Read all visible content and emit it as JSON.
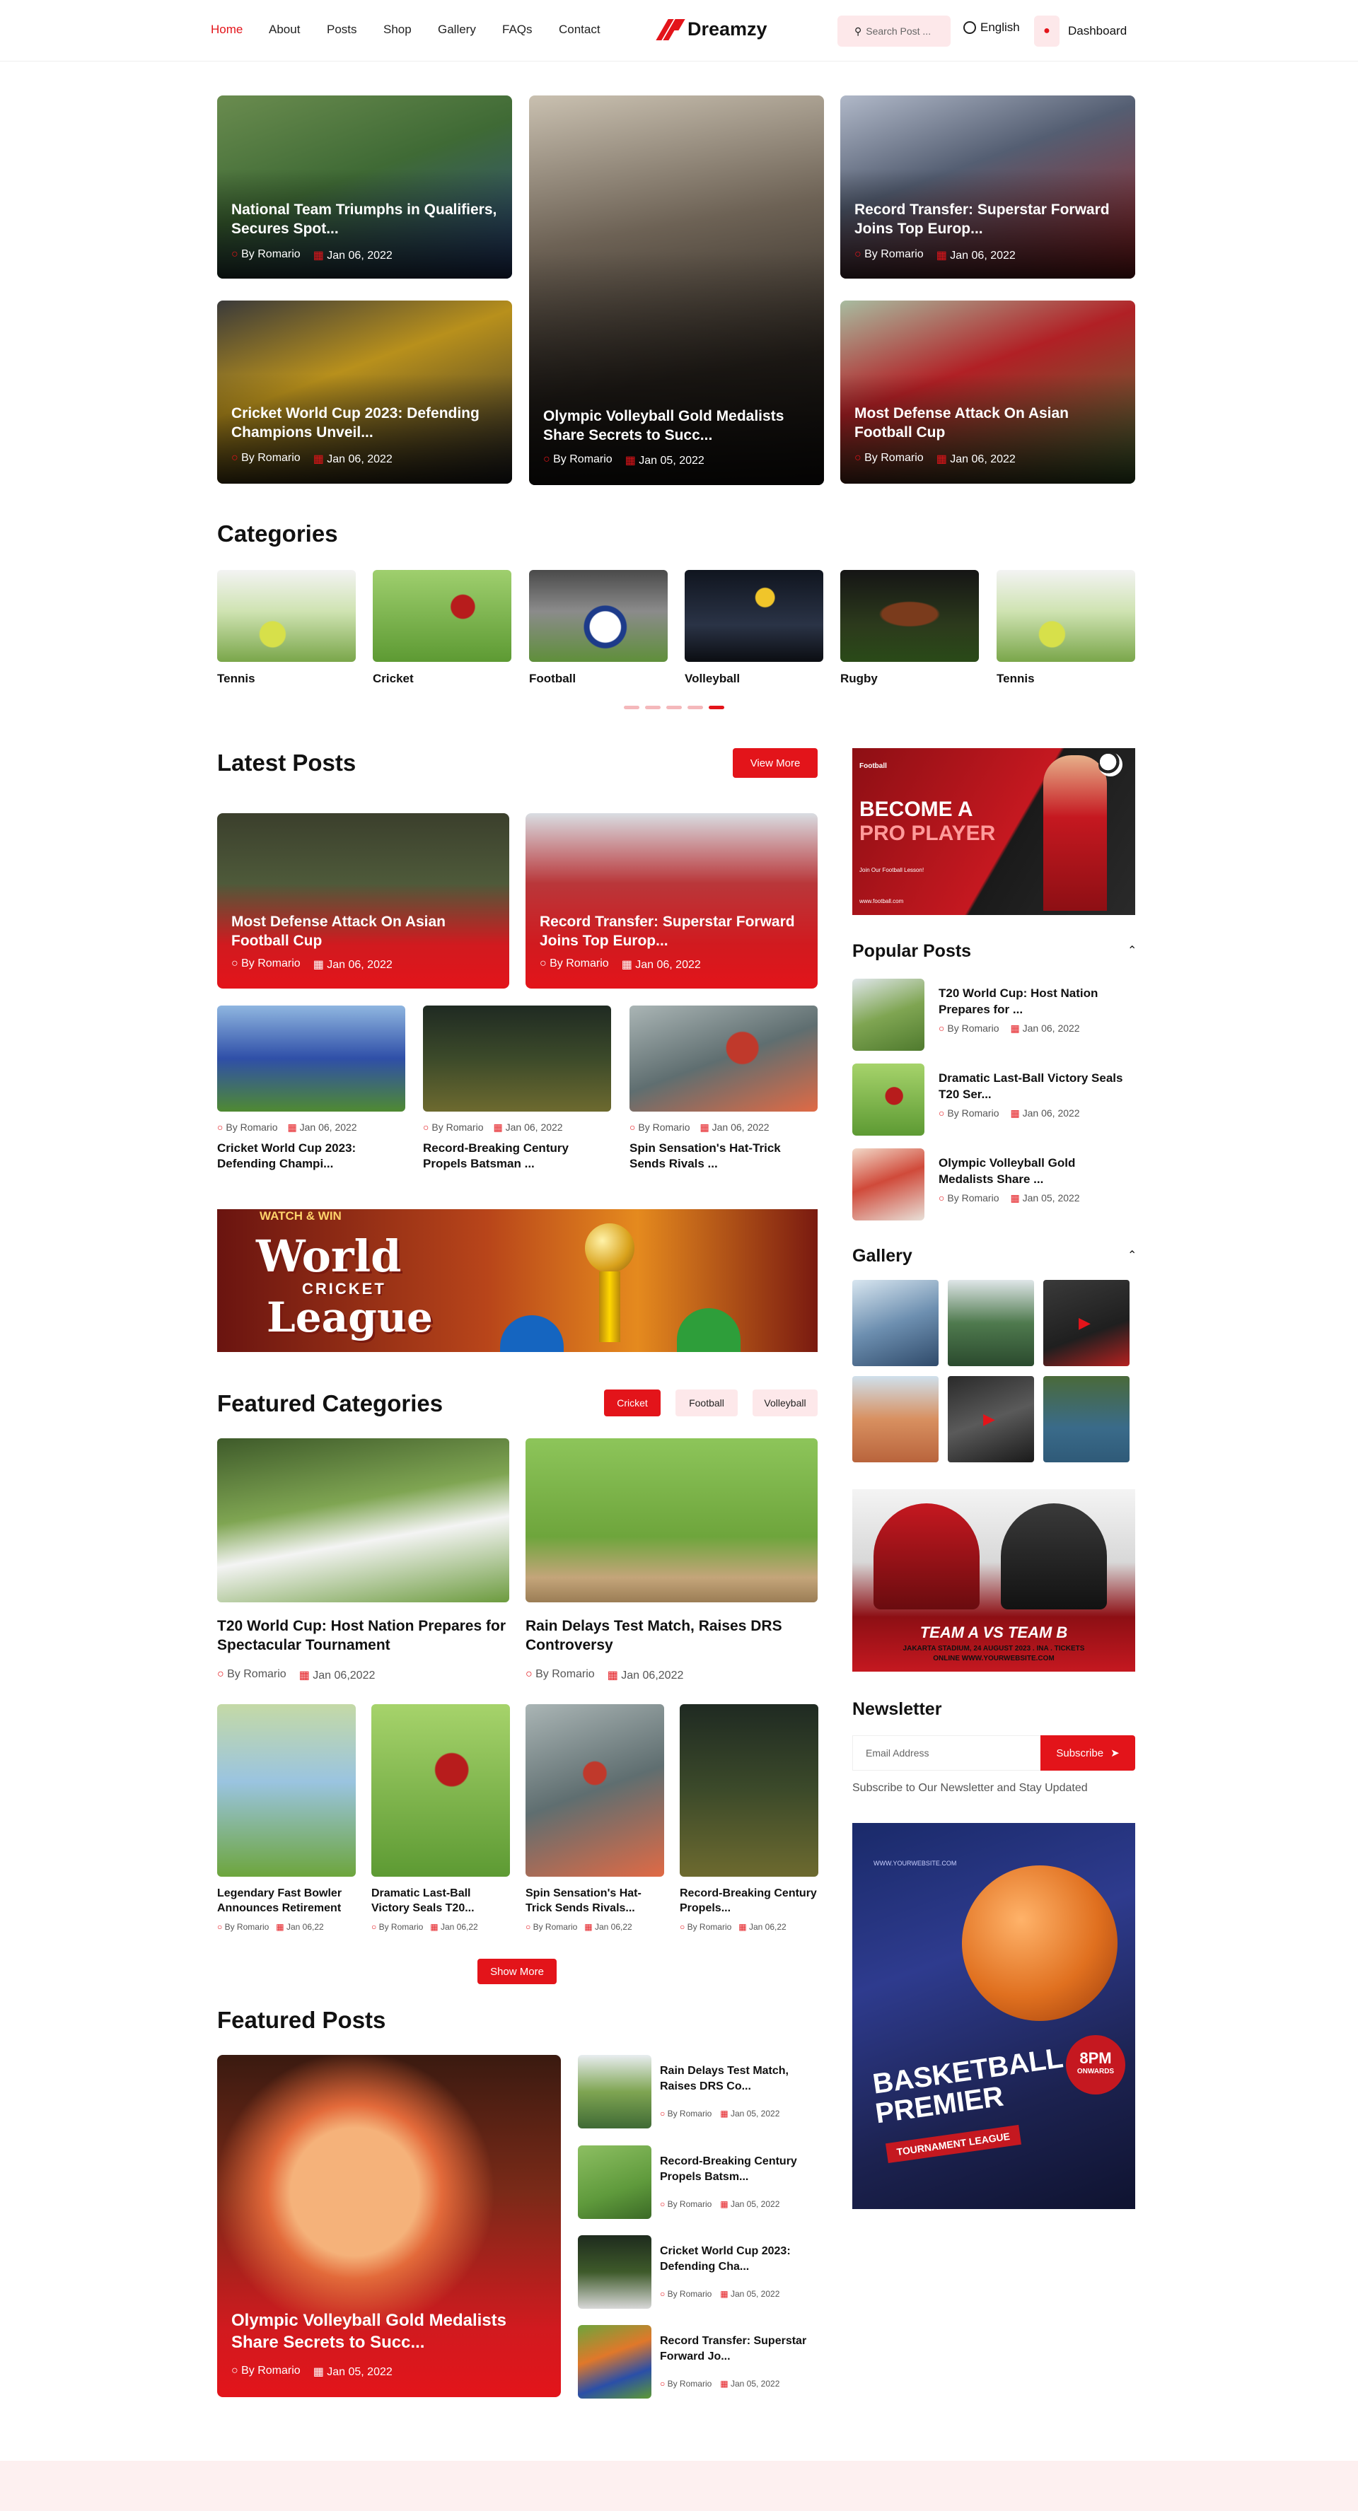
{
  "brand": {
    "name": "Dreamzy",
    "accent": "#e3141a"
  },
  "nav": {
    "items": [
      "Home",
      "About",
      "Posts",
      "Shop",
      "Gallery",
      "FAQs",
      "Contact"
    ],
    "active": "Home"
  },
  "header": {
    "search_placeholder": "Search Post ...",
    "language": "English",
    "dashboard": "Dashboard"
  },
  "hero": [
    {
      "title": "National Team Triumphs in Qualifiers, Secures Spot...",
      "author": "By Romario",
      "date": "Jan 06, 2022"
    },
    {
      "title": "Olympic Volleyball Gold Medalists Share Secrets to Succ...",
      "author": "By Romario",
      "date": "Jan 05, 2022"
    },
    {
      "title": "Record Transfer: Superstar Forward Joins Top Europ...",
      "author": "By Romario",
      "date": "Jan 06, 2022"
    },
    {
      "title": "Cricket World Cup 2023: Defending Champions Unveil...",
      "author": "By Romario",
      "date": "Jan 06, 2022"
    },
    {
      "title": "Most Defense Attack On Asian Football Cup",
      "author": "By Romario",
      "date": "Jan 06, 2022"
    }
  ],
  "categories": {
    "title": "Categories",
    "items": [
      "Tennis",
      "Cricket",
      "Football",
      "Volleyball",
      "Rugby",
      "Tennis"
    ],
    "active_page": 4
  },
  "latest": {
    "title": "Latest Posts",
    "view_more": "View More",
    "big": [
      {
        "title": "Most Defense Attack On Asian Football Cup",
        "author": "By Romario",
        "date": "Jan 06, 2022"
      },
      {
        "title": "Record Transfer: Superstar Forward Joins Top Europ...",
        "author": "By Romario",
        "date": "Jan 06, 2022"
      }
    ],
    "small": [
      {
        "title": "Cricket World Cup 2023: Defending Champi...",
        "author": "By Romario",
        "date": "Jan 06, 2022"
      },
      {
        "title": "Record-Breaking Century Propels Batsman ...",
        "author": "By Romario",
        "date": "Jan 06, 2022"
      },
      {
        "title": "Spin Sensation's Hat-Trick Sends Rivals ...",
        "author": "By Romario",
        "date": "Jan 06, 2022"
      }
    ]
  },
  "banner": {
    "top": "WATCH & WIN",
    "line1": "World",
    "line2": "CRICKET",
    "line3": "League"
  },
  "featured_categories": {
    "title": "Featured Categories",
    "tabs": [
      "Cricket",
      "Football",
      "Volleyball"
    ],
    "big": [
      {
        "title": "T20 World Cup: Host Nation Prepares for Spectacular Tournament",
        "author": "By Romario",
        "date": "Jan 06,2022"
      },
      {
        "title": "Rain Delays Test Match, Raises DRS Controversy",
        "author": "By Romario",
        "date": "Jan 06,2022"
      }
    ],
    "small": [
      {
        "title": "Legendary Fast Bowler Announces Retirement",
        "author": "By Romario",
        "date": "Jan 06,22"
      },
      {
        "title": "Dramatic Last-Ball Victory Seals T20...",
        "author": "By Romario",
        "date": "Jan 06,22"
      },
      {
        "title": "Spin Sensation's Hat-Trick Sends Rivals...",
        "author": "By Romario",
        "date": "Jan 06,22"
      },
      {
        "title": "Record-Breaking Century Propels...",
        "author": "By Romario",
        "date": "Jan 06,22"
      }
    ],
    "show_more": "Show More"
  },
  "featured_posts": {
    "title": "Featured Posts",
    "main": {
      "title": "Olympic Volleyball Gold Medalists Share Secrets to Succ...",
      "author": "By Romario",
      "date": "Jan 05, 2022"
    },
    "list": [
      {
        "title": "Rain Delays Test Match, Raises DRS Co...",
        "author": "By Romario",
        "date": "Jan 05, 2022"
      },
      {
        "title": "Record-Breaking Century Propels Batsm...",
        "author": "By Romario",
        "date": "Jan 05, 2022"
      },
      {
        "title": "Cricket World Cup 2023: Defending Cha...",
        "author": "By Romario",
        "date": "Jan 05, 2022"
      },
      {
        "title": "Record Transfer: Superstar Forward Jo...",
        "author": "By Romario",
        "date": "Jan 05, 2022"
      }
    ]
  },
  "sidebar": {
    "ad1": {
      "brand": "Football",
      "headline1": "BECOME A",
      "headline2": "PRO PLAYER",
      "sub": "Join Our Football Lesson!",
      "url": "www.football.com"
    },
    "popular": {
      "title": "Popular Posts",
      "items": [
        {
          "title": "T20 World Cup: Host Nation Prepares for ...",
          "author": "By Romario",
          "date": "Jan 06, 2022"
        },
        {
          "title": "Dramatic Last-Ball Victory Seals T20 Ser...",
          "author": "By Romario",
          "date": "Jan 06, 2022"
        },
        {
          "title": "Olympic Volleyball Gold Medalists Share ...",
          "author": "By Romario",
          "date": "Jan 05, 2022"
        }
      ]
    },
    "gallery": {
      "title": "Gallery"
    },
    "ad2": {
      "match": "TEAM A VS TEAM B",
      "line1": "JAKARTA STADIUM, 24 AUGUST 2023 . INA . TICKETS",
      "line2": "ONLINE WWW.YOURWEBSITE.COM"
    },
    "newsletter": {
      "title": "Newsletter",
      "placeholder": "Email Address",
      "button": "Subscribe",
      "note": "Subscribe to Our Newsletter and Stay Updated"
    },
    "ad3": {
      "url": "WWW.YOURWEBSITE.COM",
      "title1": "BASKETBALL",
      "title2": "PREMIER",
      "ribbon": "TOURNAMENT LEAGUE",
      "badge1": "8PM",
      "badge2": "ONWARDS"
    }
  }
}
